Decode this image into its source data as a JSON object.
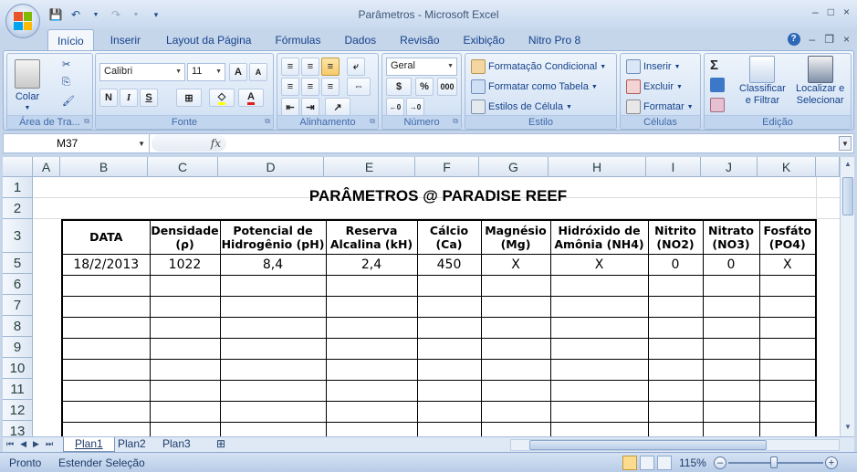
{
  "window": {
    "title": "Parâmetros - Microsoft Excel",
    "controls": [
      "–",
      "□",
      "×"
    ]
  },
  "ribbon_tabs": [
    "Início",
    "Inserir",
    "Layout da Página",
    "Fórmulas",
    "Dados",
    "Revisão",
    "Exibição",
    "Nitro Pro 8"
  ],
  "ribbon": {
    "clipboard": {
      "label": "Área de Tra...",
      "paste": "Colar"
    },
    "font": {
      "label": "Fonte",
      "name": "Calibri",
      "size": "11",
      "bold": "N",
      "italic": "I",
      "underline": "S"
    },
    "alignment": {
      "label": "Alinhamento"
    },
    "number": {
      "label": "Número",
      "format": "Geral",
      "percent": "%",
      "thousands": "000",
      "inc_dec": ",0\n,00",
      "dec_dec": ",00\n,0"
    },
    "styles": {
      "label": "Estilo",
      "conditional": "Formatação Condicional",
      "table": "Formatar como Tabela",
      "cell": "Estilos de Célula"
    },
    "cells": {
      "label": "Células",
      "insert": "Inserir",
      "delete": "Excluir",
      "format": "Formatar"
    },
    "editing": {
      "label": "Edição",
      "sort": "Classificar",
      "sort2": "e Filtrar",
      "find": "Localizar e",
      "find2": "Selecionar"
    }
  },
  "formula_bar": {
    "name_box": "M37",
    "fx": "fx",
    "value": ""
  },
  "columns": [
    "A",
    "B",
    "C",
    "D",
    "E",
    "F",
    "G",
    "H",
    "I",
    "J",
    "K"
  ],
  "rows": [
    "1",
    "2",
    "3",
    "5",
    "6",
    "7",
    "8",
    "9",
    "10",
    "11",
    "12",
    "13"
  ],
  "sheet_title": "PARÂMETROS @ PARADISE REEF",
  "table": {
    "headers": [
      [
        "DATA",
        ""
      ],
      [
        "Densidade",
        "(ρ)"
      ],
      [
        "Potencial de",
        "Hidrogênio (pH)"
      ],
      [
        "Reserva",
        "Alcalina (kH)"
      ],
      [
        "Cálcio",
        "(Ca)"
      ],
      [
        "Magnésio",
        "(Mg)"
      ],
      [
        "Hidróxido de",
        "Amônia (NH4)"
      ],
      [
        "Nitrito",
        "(NO2)"
      ],
      [
        "Nitrato",
        "(NO3)"
      ],
      [
        "Fosfáto",
        "(PO4)"
      ]
    ],
    "rows": [
      [
        "18/2/2013",
        "1022",
        "8,4",
        "2,4",
        "450",
        "X",
        "X",
        "0",
        "0",
        "X"
      ]
    ]
  },
  "sheet_tabs": [
    "Plan1",
    "Plan2",
    "Plan3"
  ],
  "status": {
    "mode": "Pronto",
    "selection": "Estender Seleção",
    "zoom": "115%"
  }
}
